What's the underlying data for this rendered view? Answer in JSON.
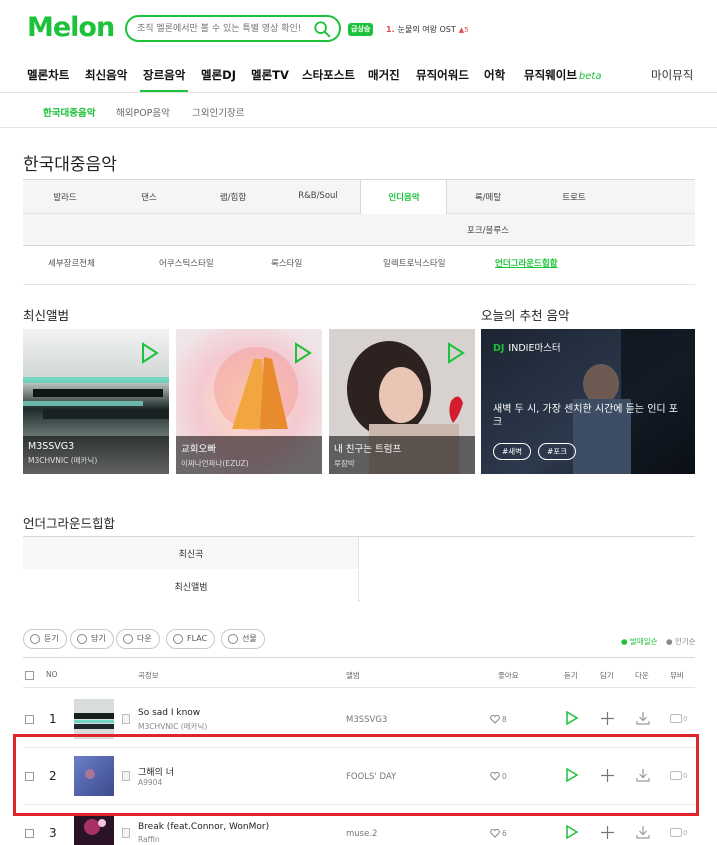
{
  "header": {
    "logo": "Melon",
    "search_placeholder": "조직 멜론에서만 볼 수 있는 특별 영상 확인!",
    "realtime_badge": "급상승",
    "realtime_rank": "1.",
    "realtime_title": "눈물의 여왕 OST",
    "realtime_change": "▲5"
  },
  "gnb": {
    "items": [
      "멜론차트",
      "최신음악",
      "장르음악",
      "멜론DJ",
      "멜론TV",
      "스타포스트",
      "매거진",
      "뮤직어워드",
      "어학",
      "뮤직웨이브"
    ],
    "beta": "beta",
    "my_music": "마이뮤직"
  },
  "subnav": [
    "한국대중음악",
    "해외POP음악",
    "그외인기장르"
  ],
  "page_title": "한국대중음악",
  "genres": {
    "row1": [
      "발라드",
      "댄스",
      "랩/힙합",
      "R&B/Soul",
      "인디음악",
      "록/메탈",
      "트로트"
    ],
    "row2": [
      "포크/블루스"
    ],
    "sub": [
      "세부장르전체",
      "어쿠스틱스타일",
      "록스타일",
      "일렉트로닉스타일",
      "언더그라운드힙합"
    ]
  },
  "latest_albums": {
    "title": "최신앨범",
    "albums": [
      {
        "title": "M3SSVG3",
        "artist": "M3CHVNIC (메카닉)"
      },
      {
        "title": "교회오빠",
        "artist": "이짜나언짜나(EZUZ)"
      },
      {
        "title": "내 친구는 트럼프",
        "artist": "루잠박"
      }
    ]
  },
  "recommend": {
    "title": "오늘의 추천 음악",
    "dj_tag": "DJ",
    "dj_name": "INDIE마스터",
    "headline": "새벽 두 시, 가장 센치한 시간에 듣는 인디 포크",
    "tags": [
      "#새벽",
      "#포크"
    ]
  },
  "section": {
    "title": "언더그라운드힙합",
    "tab_latest_songs": "최신곡",
    "tab_latest_albums": "최신앨범"
  },
  "toolbar": {
    "listen": "듣기",
    "add": "담기",
    "download": "다운",
    "flac": "FLAC",
    "gift": "선물",
    "sort_release": "● 발매일순",
    "sort_popular": "● 인기순"
  },
  "table_headers": {
    "no": "NO",
    "song_info": "곡정보",
    "album": "앨범",
    "likes": "좋아요",
    "listen": "듣기",
    "add": "담기",
    "download": "다운",
    "mv": "뮤비"
  },
  "songs": [
    {
      "no": "1",
      "title": "So sad I know",
      "artist": "M3CHVNIC (메카닉)",
      "album": "M3SSVG3",
      "likes": "8",
      "mv": "0"
    },
    {
      "no": "2",
      "title": "그해의 너",
      "artist": "A9904",
      "album": "FOOLS' DAY",
      "likes": "0",
      "mv": "0"
    },
    {
      "no": "3",
      "title": "Break (feat.Connor, WonMor)",
      "artist": "Raffin",
      "album": "muse.2",
      "likes": "6",
      "mv": "0"
    }
  ],
  "colors": {
    "brand": "#1cc23a",
    "highlight": "#e1232a"
  }
}
